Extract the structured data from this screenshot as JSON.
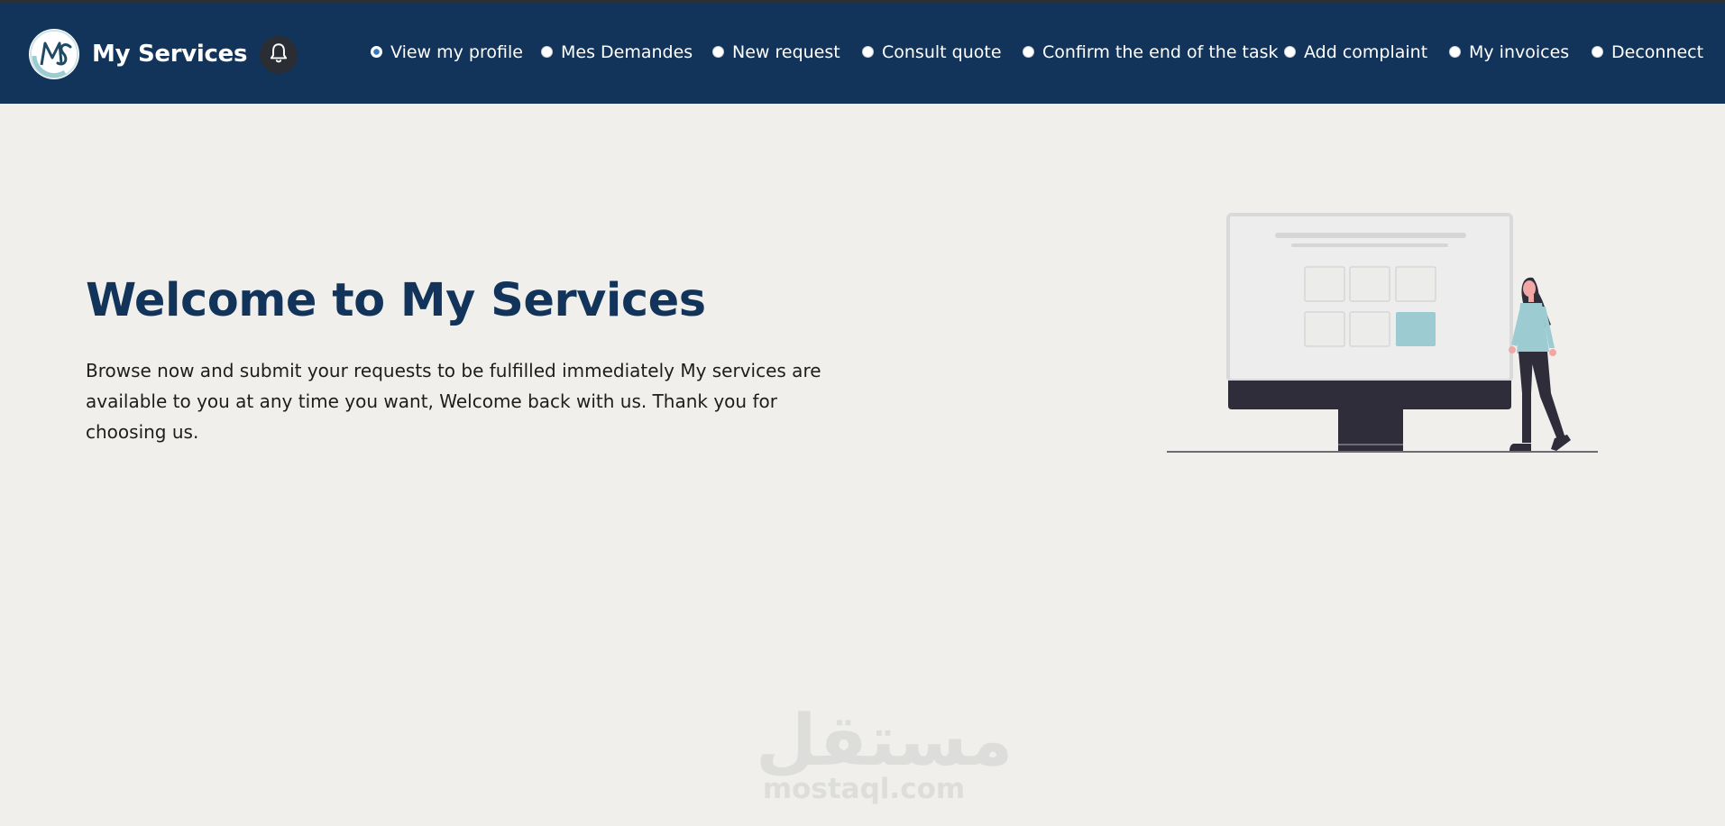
{
  "brand": {
    "logo_text": "MS",
    "name": "My Services"
  },
  "nav": {
    "items": [
      {
        "label": "View my profile",
        "selected": true
      },
      {
        "label": "Mes Demandes",
        "selected": false
      },
      {
        "label": "New request",
        "selected": false
      },
      {
        "label": "Consult quote",
        "selected": false
      },
      {
        "label": "Confirm the end of the task",
        "selected": false
      },
      {
        "label": "Add complaint",
        "selected": false
      },
      {
        "label": "My invoices",
        "selected": false
      },
      {
        "label": "Deconnect",
        "selected": false
      }
    ],
    "notification_icon": "bell-icon"
  },
  "hero": {
    "title": "Welcome to My Services",
    "text": "Browse now and submit your requests to be fulfilled immediately My services are available to you at any time you want, Welcome back with us. Thank you for choosing us."
  },
  "illustration": {
    "icon": "person-at-monitor-illustration"
  },
  "watermark": {
    "arabic": "مستقل",
    "latin": "mostaql.com"
  },
  "colors": {
    "navbar": "#12345a",
    "background": "#f0efec",
    "title": "#12345a",
    "accent_tile": "#9ccbd1"
  }
}
